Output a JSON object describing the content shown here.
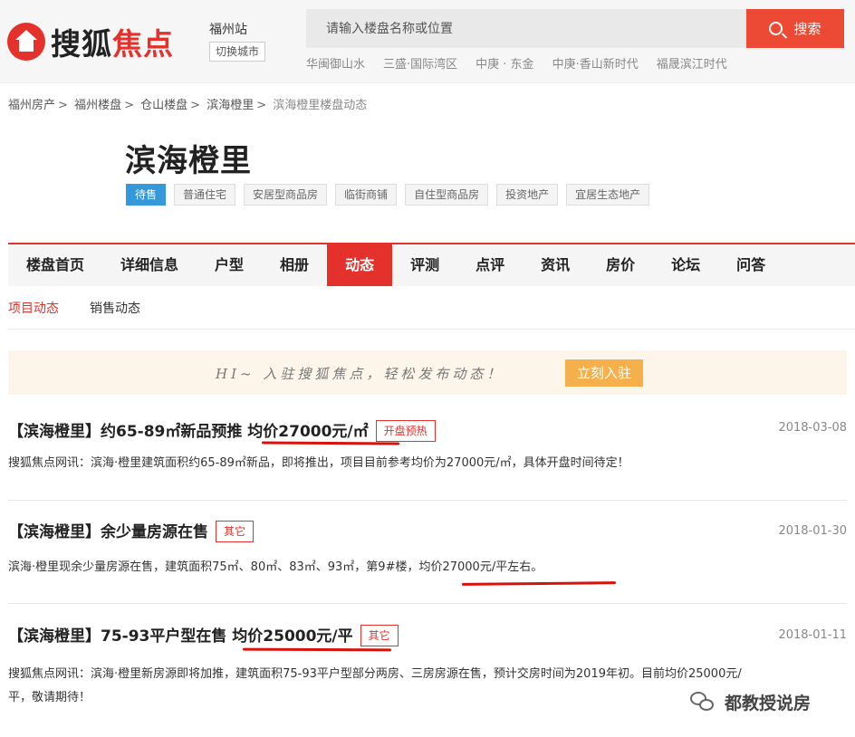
{
  "header": {
    "logo_part1": "搜狐",
    "logo_part2": "焦点",
    "city": "福州站",
    "switch_city": "切换城市",
    "search_placeholder": "请输入楼盘名称或位置",
    "search_button": "搜索",
    "hot_links": [
      "华闽御山水",
      "三盛·国际湾区",
      "中庚 · 东金",
      "中庚·香山新时代",
      "福晟滨江时代"
    ]
  },
  "breadcrumb": {
    "items": [
      "福州房产",
      "福州楼盘",
      "仓山楼盘",
      "滨海橙里"
    ],
    "current": "滨海橙里楼盘动态",
    "separator": ">"
  },
  "project": {
    "title": "滨海橙里",
    "tags": [
      "待售",
      "普通住宅",
      "安居型商品房",
      "临街商铺",
      "自住型商品房",
      "投资地产",
      "宜居生态地产"
    ]
  },
  "nav": {
    "items": [
      "楼盘首页",
      "详细信息",
      "户型",
      "相册",
      "动态",
      "评测",
      "点评",
      "资讯",
      "房价",
      "论坛",
      "问答"
    ]
  },
  "subtabs": [
    "项目动态",
    "销售动态"
  ],
  "banner": {
    "text": "HI~ 入驻搜狐焦点，轻松发布动态！",
    "button": "立刻入驻"
  },
  "news": [
    {
      "title": "【滨海橙里】约65-89㎡新品预推 均价27000元/㎡",
      "badge": "开盘预热",
      "date": "2018-03-08",
      "body": "搜狐焦点网讯：滨海·橙里建筑面积约65-89㎡新品，即将推出，项目目前参考均价为27000元/㎡，具体开盘时间待定！"
    },
    {
      "title": "【滨海橙里】余少量房源在售",
      "badge": "其它",
      "date": "2018-01-30",
      "body": "滨海·橙里现余少量房源在售，建筑面积75㎡、80㎡、83㎡、93㎡，第9#楼，均价27000元/平左右。"
    },
    {
      "title": "【滨海橙里】75-93平户型在售 均价25000元/平",
      "badge": "其它",
      "date": "2018-01-11",
      "body_line1": "搜狐焦点网讯：滨海·橙里新房源即将加推，建筑面积75-93平户型部分两房、三房房源在售，预计交房时间为2019年初。目前均价25000元/",
      "body_line2": "平，敬请期待！"
    }
  ],
  "watermark": "都教授说房",
  "colors": {
    "brand_red": "#e4312b",
    "search_orange": "#ec4a34",
    "tag_blue": "#3498db",
    "banner_button": "#f5b04b",
    "annotation_red": "#d7120b"
  }
}
